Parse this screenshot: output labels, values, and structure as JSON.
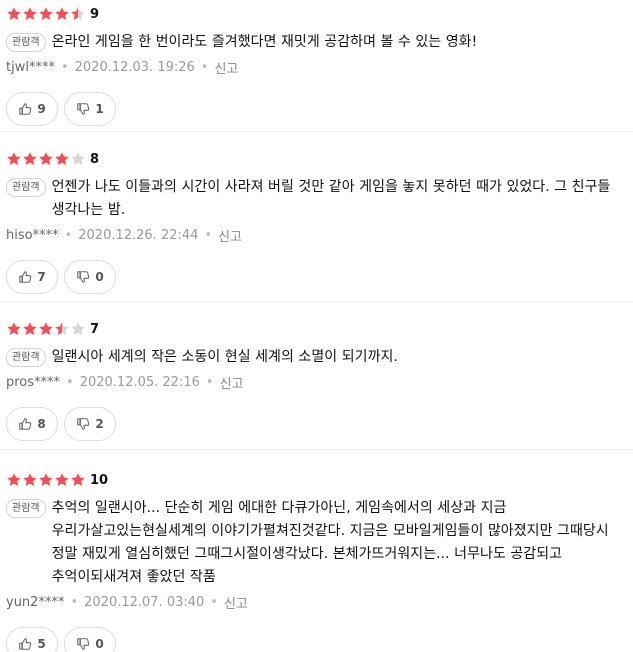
{
  "colors": {
    "star_on": "#ef4f56",
    "star_off": "#d6d6d6",
    "border": "#dddddd"
  },
  "icons": {
    "like": "thumbs-up-icon",
    "dislike": "thumbs-down-icon",
    "star": "star-icon"
  },
  "reviews": [
    {
      "rating": 4.5,
      "score": "9",
      "badge": "관람객",
      "text": "온라인 게임을 한 번이라도 즐겨했다면 재밋게 공감하며 볼 수 있는 영화!",
      "user": "tjwl****",
      "date": "2020.12.03. 19:26",
      "report": "신고",
      "likes": "9",
      "dislikes": "1"
    },
    {
      "rating": 4,
      "score": "8",
      "badge": "관람객",
      "text": "언젠가 나도 이들과의 시간이 사라져 버릴 것만 같아 게임을 놓지 못하던 때가 있었다. 그 친구들 생각나는 밤.",
      "user": "hiso****",
      "date": "2020.12.26. 22:44",
      "report": "신고",
      "likes": "7",
      "dislikes": "0"
    },
    {
      "rating": 3.5,
      "score": "7",
      "badge": "관람객",
      "text": "일랜시아 세계의 작은 소동이 현실 세계의 소멸이 되기까지.",
      "user": "pros****",
      "date": "2020.12.05. 22:16",
      "report": "신고",
      "likes": "8",
      "dislikes": "2"
    },
    {
      "rating": 5,
      "score": "10",
      "badge": "관람객",
      "text": "추억의 일랜시아... 단순히 게임 에대한 다큐가아닌, 게임속에서의 세상과 지금 우리가살고있는현실세계의 이야기가펼쳐진것같다. 지금은 모바일게임들이 많아졌지만 그때당시 정말 재밌게 열심히했던 그때그시절이생각났다. 본체가뜨거워지는... 너무나도 공감되고 추억이되새겨져 좋았던 작품",
      "user": "yun2****",
      "date": "2020.12.07. 03:40",
      "report": "신고",
      "likes": "5",
      "dislikes": "0"
    }
  ]
}
